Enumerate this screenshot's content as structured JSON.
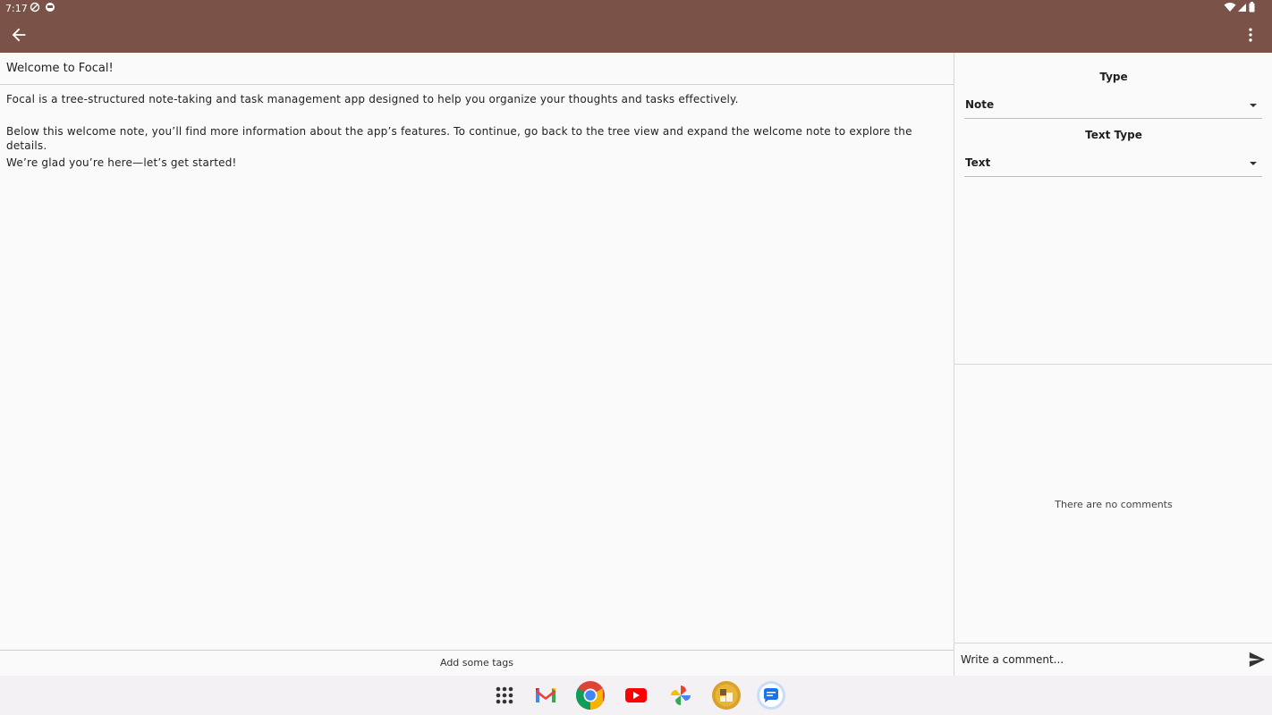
{
  "status_bar": {
    "time": "7:17",
    "left_icons": [
      "vpn-key-icon",
      "notification-icon"
    ],
    "right_icons": [
      "wifi-icon",
      "signal-icon",
      "battery-icon"
    ]
  },
  "app_bar": {
    "color": "#7b5247",
    "back_icon": "back-arrow-icon",
    "menu_icon": "more-vert-icon"
  },
  "note": {
    "title": "Welcome to Focal!",
    "paragraphs": [
      "Focal is a tree-structured note-taking and task management app designed to help you organize your thoughts and tasks effectively.",
      "Below this welcome note, you’ll find more information about the app’s features. To continue, go back to the tree view and expand the welcome note to explore the details.",
      "We’re glad you’re here—let’s get started!"
    ],
    "tags_placeholder": "Add some tags"
  },
  "properties": {
    "type_label": "Type",
    "type_value": "Note",
    "text_type_label": "Text Type",
    "text_type_value": "Text"
  },
  "comments": {
    "empty_text": "There are no comments",
    "input_placeholder": "Write a comment...",
    "send_icon": "send-icon"
  },
  "dock": {
    "apps": [
      "app-drawer-icon",
      "gmail-icon",
      "chrome-icon",
      "youtube-icon",
      "photos-icon",
      "focal-app-icon",
      "messages-icon"
    ]
  }
}
